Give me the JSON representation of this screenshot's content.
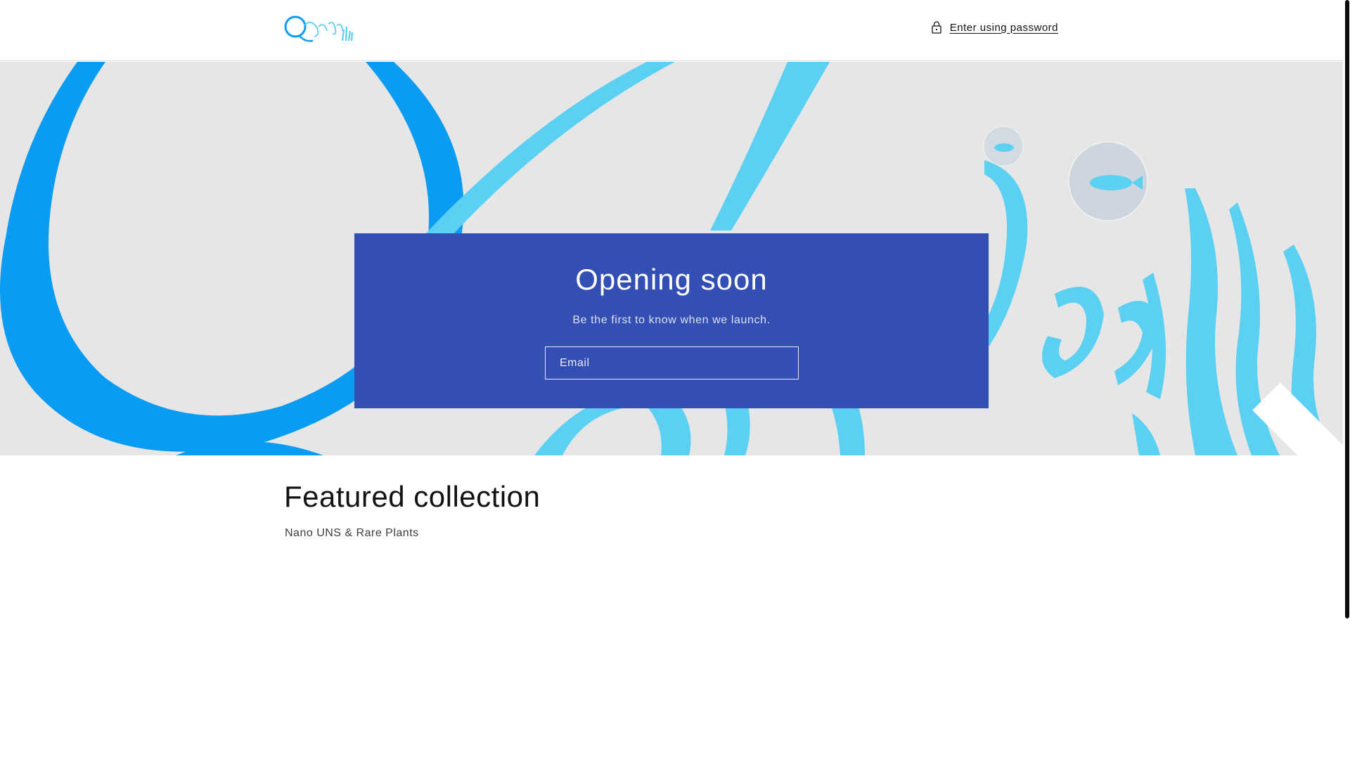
{
  "header": {
    "logo_alt": "QSquares",
    "password_link_label": "Enter using password",
    "password_icon": "lock-icon"
  },
  "signup": {
    "title": "Opening soon",
    "subtitle": "Be the first to know when we launch.",
    "email_placeholder": "Email",
    "submit_icon": "arrow-right-icon",
    "box_color": "#334fb4"
  },
  "featured": {
    "title": "Featured collection",
    "subtitle": "Nano UNS & Rare Plants"
  },
  "colors": {
    "brand_blue": "#0a9bf2",
    "brand_light_blue": "#5bd0f3",
    "banner_bg": "#e6e6e6"
  }
}
